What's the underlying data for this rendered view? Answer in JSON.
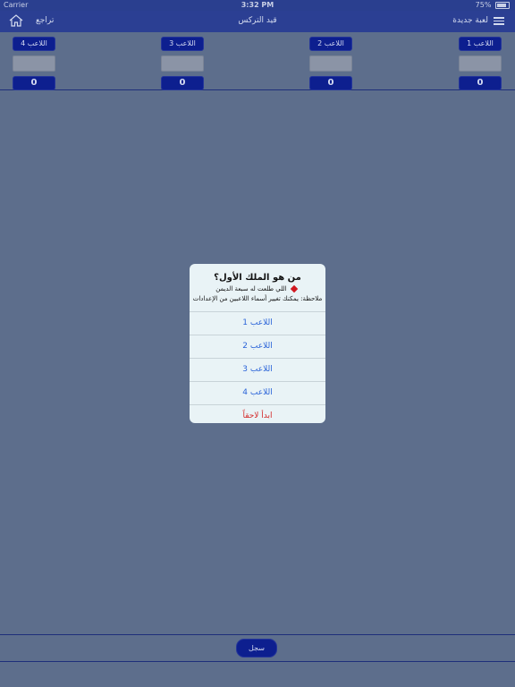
{
  "status_bar": {
    "carrier": "Carrier",
    "time": "3:32 PM",
    "battery": "75%"
  },
  "nav": {
    "undo_label": "تراجع",
    "title": "قيد التركس",
    "new_game_label": "لعبة جديدة"
  },
  "players": [
    {
      "name": "اللاعب 4",
      "score": "0"
    },
    {
      "name": "اللاعب 3",
      "score": "0"
    },
    {
      "name": "اللاعب 2",
      "score": "0"
    },
    {
      "name": "اللاعب 1",
      "score": "0"
    }
  ],
  "record_label": "سجل",
  "dialog": {
    "title": "من هو الملك الأول؟",
    "message": "اللي طلعت له سبعة الديمن",
    "note": "ملاحظة: يمكنك تغيير أسماء اللاعبين من الإعدادات",
    "options": [
      "اللاعب 1",
      "اللاعب 2",
      "اللاعب 3",
      "اللاعب 4"
    ],
    "cancel": "ابدأ لاحقاً"
  },
  "colors": {
    "nav_bg": "#2b3f93",
    "button_bg": "#0d1f8f",
    "overlay": "#5d6e8c",
    "dialog_bg": "#e9f3f6",
    "option_text": "#2a63d8",
    "cancel_text": "#d42a2a",
    "diamond": "#d01820"
  }
}
